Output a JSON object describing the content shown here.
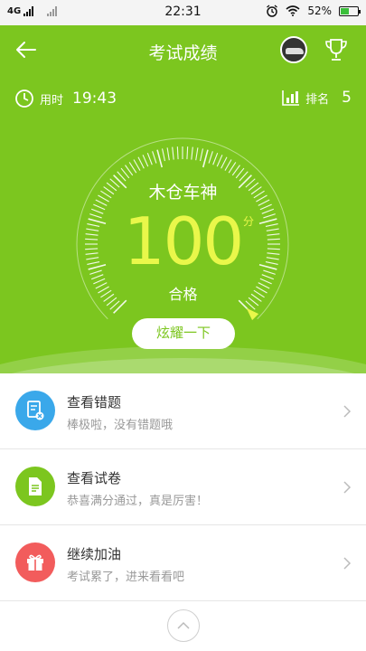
{
  "status_bar": {
    "network": "4G",
    "time": "22:31",
    "battery": "52%",
    "battery_level": 0.52
  },
  "header": {
    "title": "考试成绩",
    "back_icon": "arrow-left-icon",
    "trophy_icon": "trophy-icon"
  },
  "stats": {
    "time_label": "用时",
    "time_value": "19:43",
    "rank_label": "排名",
    "rank_value": "5"
  },
  "result": {
    "player_name": "木仓车神",
    "score": "100",
    "score_unit": "分",
    "verdict": "合格",
    "share_label": "炫耀一下",
    "gauge_fraction": 1.0
  },
  "menu": [
    {
      "title": "查看错题",
      "subtitle": "棒极啦，没有错题哦",
      "icon": "error-list-icon",
      "color": "#3aa8ea"
    },
    {
      "title": "查看试卷",
      "subtitle": "恭喜满分通过，真是厉害！",
      "icon": "document-icon",
      "color": "#7cc61f"
    },
    {
      "title": "继续加油",
      "subtitle": "考试累了，进来看看吧",
      "icon": "gift-icon",
      "color": "#f25c5c"
    }
  ],
  "colors": {
    "primary": "#7cc61f",
    "score": "#e9f74a"
  }
}
